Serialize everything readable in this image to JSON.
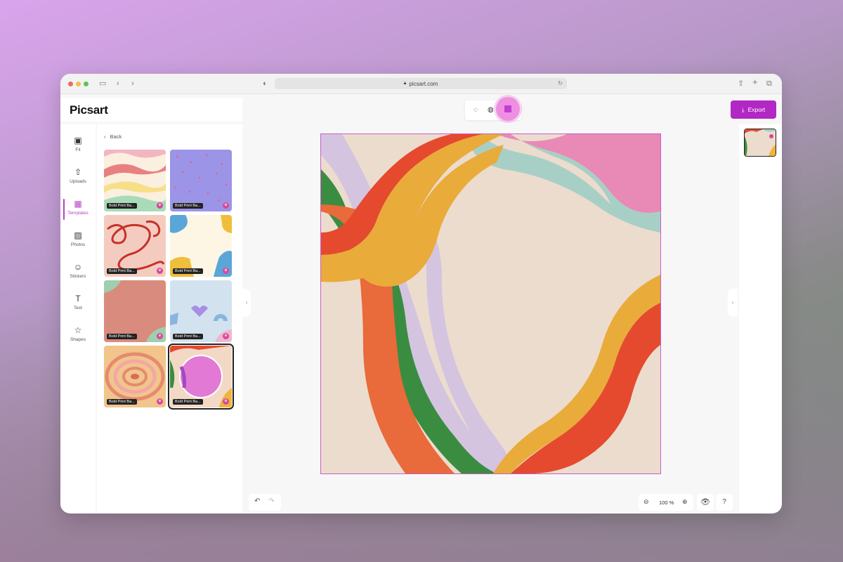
{
  "browser": {
    "url": "picsart.com",
    "lock_icon": "lock-icon"
  },
  "app": {
    "logo": "Picsart"
  },
  "sidebar": {
    "items": [
      {
        "label": "Fit",
        "icon": "fit-icon"
      },
      {
        "label": "Uploads",
        "icon": "upload-icon"
      },
      {
        "label": "Templates",
        "icon": "templates-icon",
        "active": true
      },
      {
        "label": "Photos",
        "icon": "photos-icon"
      },
      {
        "label": "Stickers",
        "icon": "stickers-icon"
      },
      {
        "label": "Text",
        "icon": "text-icon"
      },
      {
        "label": "Shapes",
        "icon": "star-icon"
      }
    ]
  },
  "panel": {
    "back_label": "Back",
    "templates": [
      {
        "tag": "Bold Print Ba..."
      },
      {
        "tag": "Bold Print Ba..."
      },
      {
        "tag": "Bold Print Ba..."
      },
      {
        "tag": "Bold Print Ba..."
      },
      {
        "tag": "Bold Print Ba..."
      },
      {
        "tag": "Bold Print Ba..."
      },
      {
        "tag": "Bold Print Ba..."
      },
      {
        "tag": "Bold Print Ba..."
      }
    ]
  },
  "header": {
    "export_label": "Export"
  },
  "footer": {
    "zoom": "100 %"
  },
  "colors": {
    "accent": "#b228c4",
    "canvas_bg": "#ecdccd"
  }
}
